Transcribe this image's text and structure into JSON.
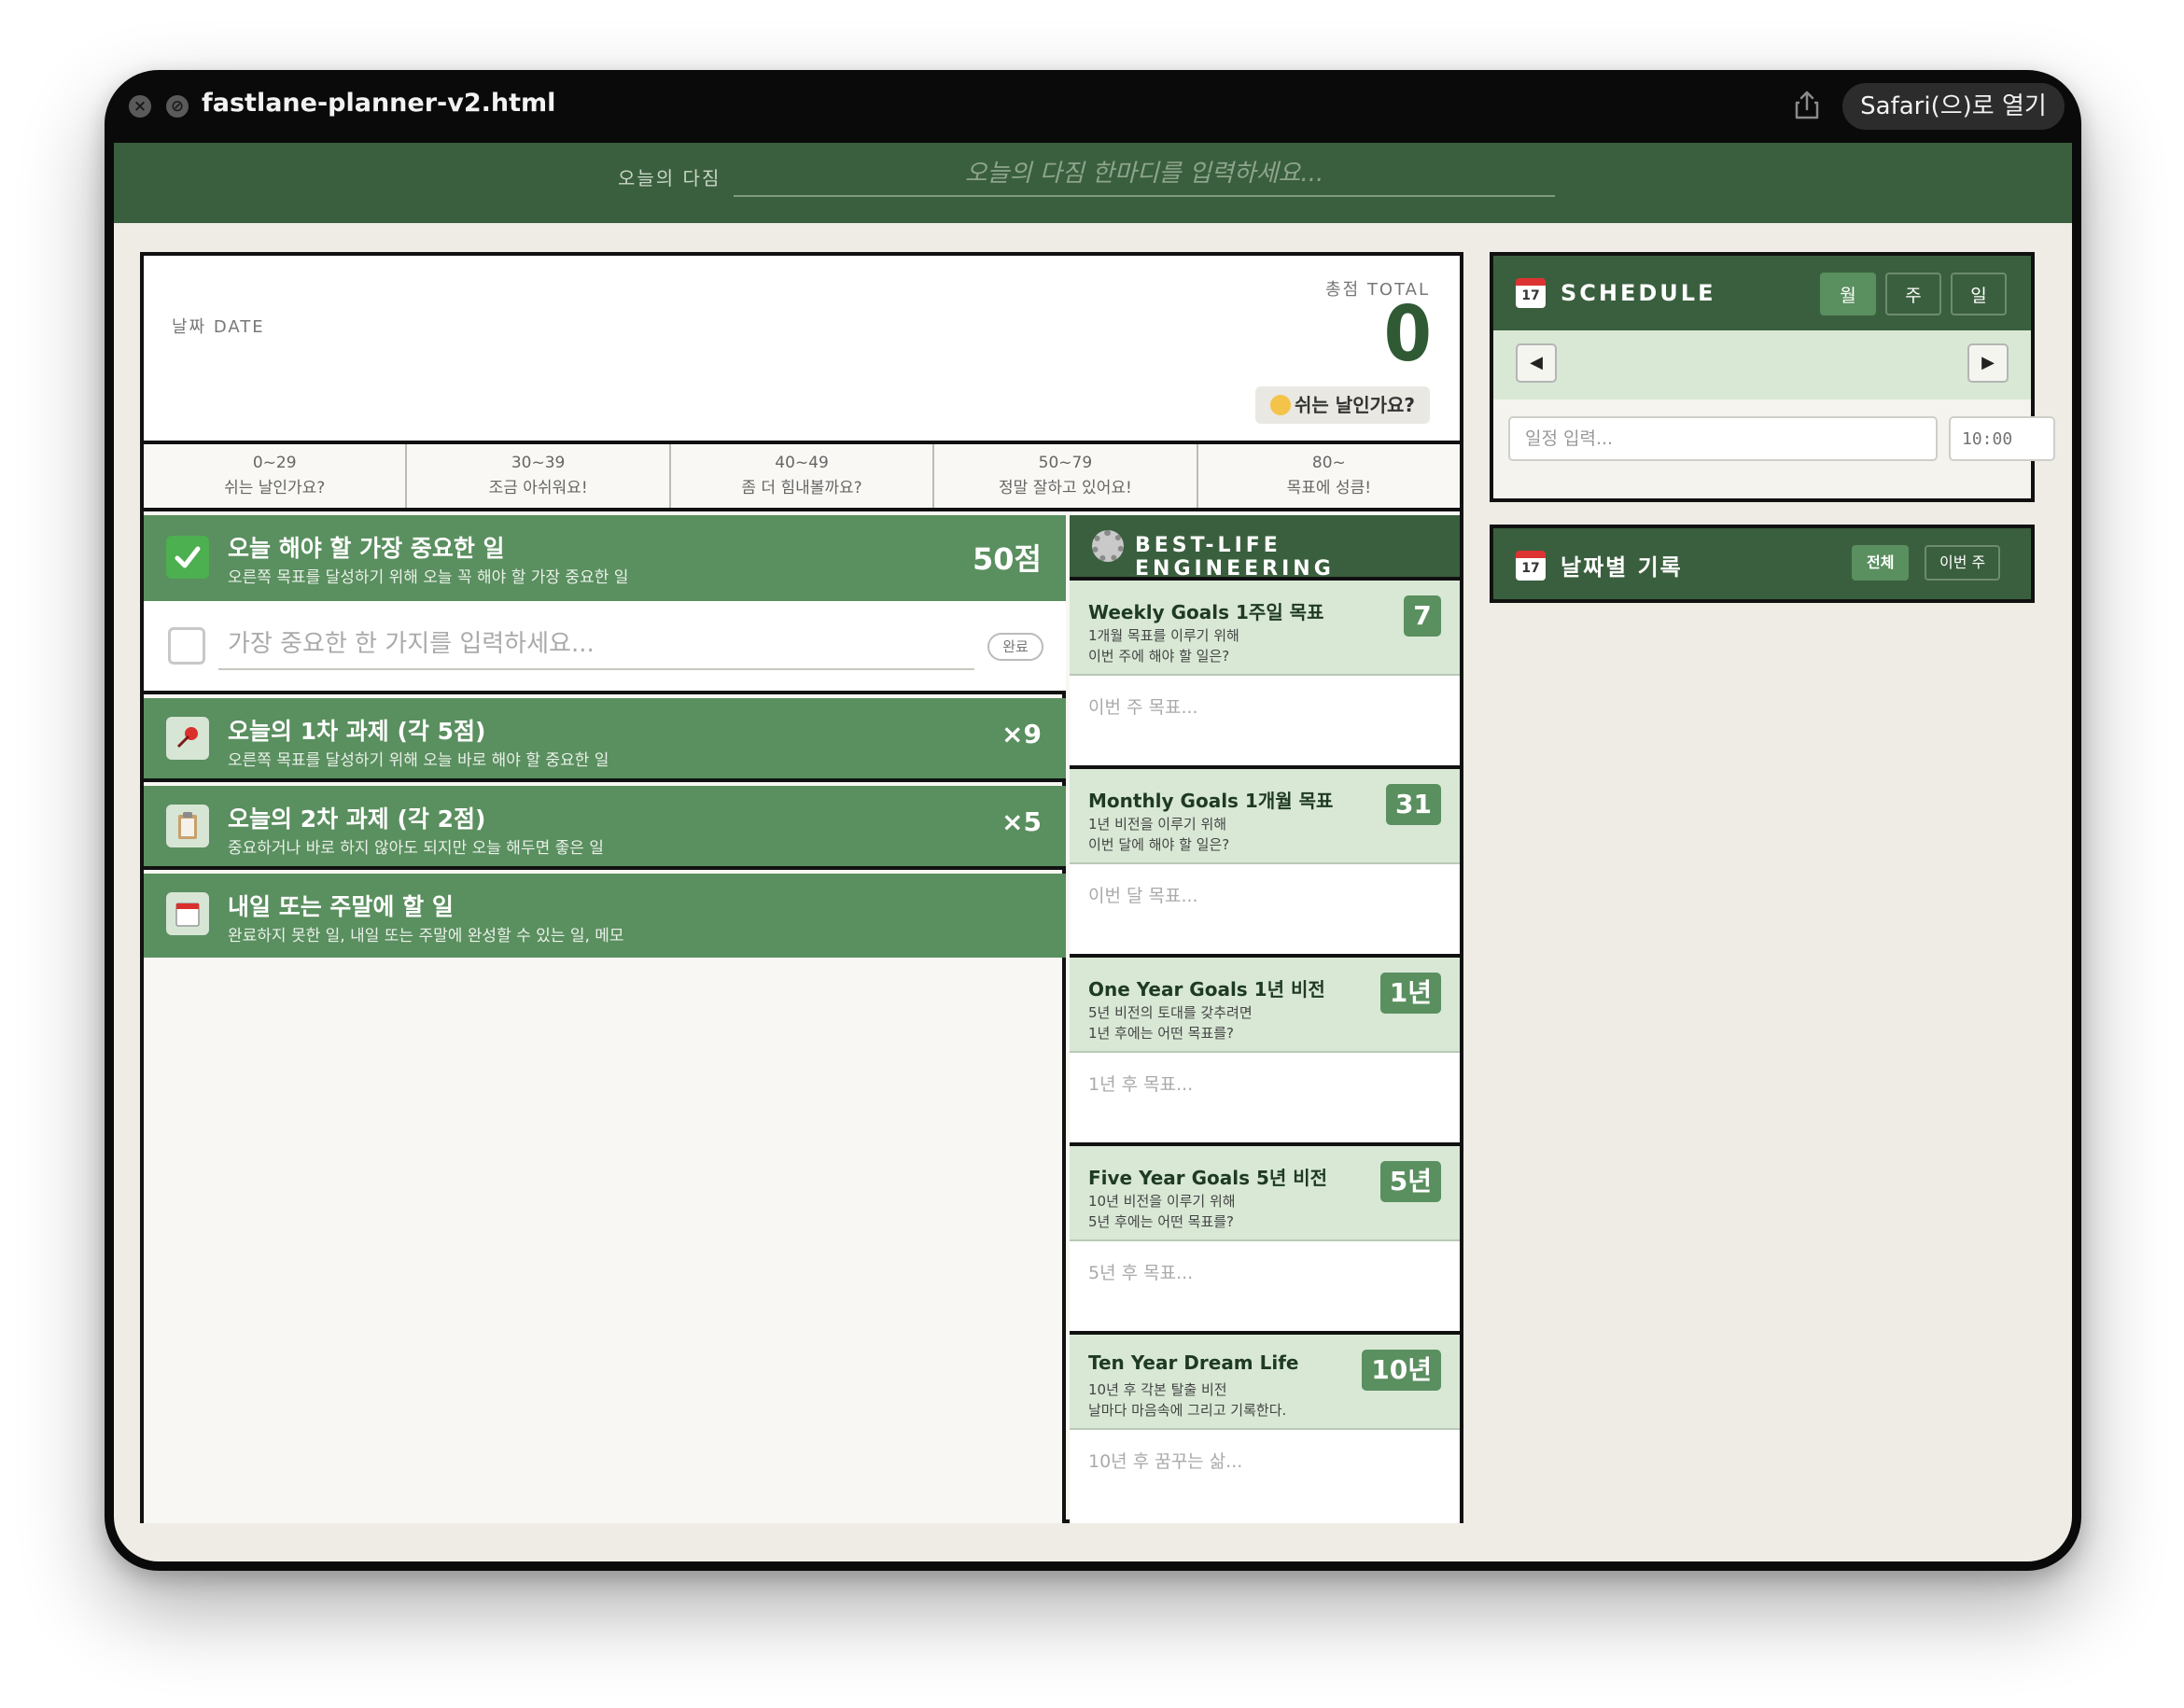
{
  "window": {
    "title": "fastlane-planner-v2.html",
    "open_in_safari": "Safari(으)로 열기"
  },
  "motto": {
    "label": "오늘의 다짐",
    "placeholder": "오늘의 다짐 한마디를 입력하세요..."
  },
  "header": {
    "date_label": "날짜 DATE",
    "total_label": "총점 TOTAL",
    "total_value": "0",
    "status_badge": "쉬는 날인가요?"
  },
  "scale": [
    {
      "range": "0~29",
      "text": "쉬는 날인가요?"
    },
    {
      "range": "30~39",
      "text": "조금 아쉬워요!"
    },
    {
      "range": "40~49",
      "text": "좀 더 힘내볼까요?"
    },
    {
      "range": "50~79",
      "text": "정말 잘하고 있어요!"
    },
    {
      "range": "80~",
      "text": "목표에 성큼!"
    }
  ],
  "sections": {
    "most_important": {
      "title": "오늘 해야 할 가장 중요한 일",
      "subtitle": "오른쪽 목표를 달성하기 위해 오늘 꼭 해야 할 가장 중요한 일",
      "points": "50점",
      "input_placeholder": "가장 중요한 한 가지를 입력하세요...",
      "done_label": "완료"
    },
    "first_tasks": {
      "title": "오늘의 1차 과제 (각 5점)",
      "subtitle": "오른쪽 목표를 달성하기 위해 오늘 바로 해야 할 중요한 일",
      "count": "×9"
    },
    "second_tasks": {
      "title": "오늘의 2차 과제 (각 2점)",
      "subtitle": "중요하거나 바로 하지 않아도 되지만 오늘 해두면 좋은 일",
      "count": "×5"
    },
    "later": {
      "title": "내일 또는 주말에 할 일",
      "subtitle": "완료하지 못한 일, 내일 또는 주말에 완성할 수 있는 일, 메모"
    }
  },
  "best_life": {
    "title": "BEST-LIFE ENGINEERING",
    "goals": [
      {
        "title": "Weekly Goals 1주일 목표",
        "desc1": "1개월 목표를 이루기 위해",
        "desc2": "이번 주에 해야 할 일은?",
        "badge": "7",
        "placeholder": "이번 주 목표..."
      },
      {
        "title": "Monthly Goals 1개월 목표",
        "desc1": "1년 비전을 이루기 위해",
        "desc2": "이번 달에 해야 할 일은?",
        "badge": "31",
        "placeholder": "이번 달 목표..."
      },
      {
        "title": "One Year Goals 1년 비전",
        "desc1": "5년 비전의 토대를 갖추려면",
        "desc2": "1년 후에는 어떤 목표를?",
        "badge": "1년",
        "placeholder": "1년 후 목표..."
      },
      {
        "title": "Five Year Goals 5년 비전",
        "desc1": "10년 비전을 이루기 위해",
        "desc2": "5년 후에는 어떤 목표를?",
        "badge": "5년",
        "placeholder": "5년 후 목표..."
      },
      {
        "title": "Ten Year Dream Life",
        "desc1": "10년 후 각본 탈출 비전",
        "desc2": "날마다 마음속에 그리고 기록한다.",
        "badge": "10년",
        "placeholder": "10년 후 꿈꾸는 삶..."
      }
    ]
  },
  "schedule": {
    "title": "SCHEDULE",
    "calendar_day": "17",
    "views": [
      "월",
      "주",
      "일"
    ],
    "active_view": "월",
    "prev": "◀",
    "next": "▶",
    "input_placeholder": "일정 입력...",
    "time_placeholder": "10:00"
  },
  "records": {
    "title": "날짜별 기록",
    "calendar_day": "17",
    "filters": [
      "전체",
      "이번 주"
    ],
    "active_filter": "전체"
  },
  "colors": {
    "primary_dark": "#3a5f3e",
    "primary": "#5a8f5f",
    "light_green": "#d8e8d5",
    "background": "#efece5",
    "total_color": "#2f5a34"
  }
}
